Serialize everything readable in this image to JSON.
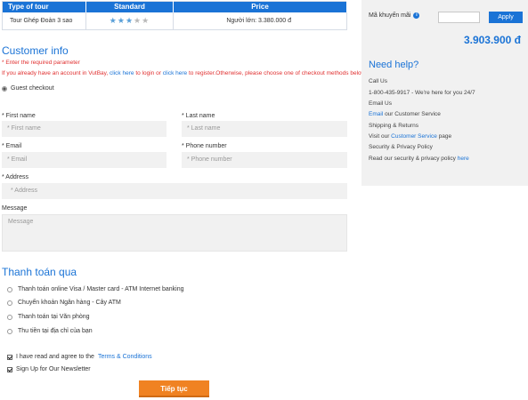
{
  "tour_table": {
    "headers": [
      "Type of tour",
      "Standard",
      "Price"
    ],
    "row": {
      "tour": "Tour Ghép Đoàn 3 sao",
      "stars_filled": 3,
      "stars_total": 5,
      "price": "Người lớn:  3.380.000 đ"
    }
  },
  "customer_info": {
    "title": "Customer info",
    "required_note": "* Enter the required parameter",
    "login_prefix": "If you already have an account in VutBay, ",
    "login_link1": "click here",
    "login_mid": " to login or ",
    "login_link2": "click here",
    "login_suffix": " to register.Otherwise, please choose one of checkout methods below",
    "guest_label": "Guest checkout"
  },
  "form": {
    "first_name": {
      "label": "First name",
      "placeholder": "* First name"
    },
    "last_name": {
      "label": "Last name",
      "placeholder": "* Last name"
    },
    "email": {
      "label": "Email",
      "placeholder": "* Email"
    },
    "phone": {
      "label": "Phone number",
      "placeholder": "* Phone number"
    },
    "address": {
      "label": "Address",
      "placeholder": "* Address"
    },
    "message": {
      "label": "Message",
      "placeholder": "Message"
    }
  },
  "payment": {
    "title": "Thanh toán qua",
    "options": [
      "Thanh toán online Visa / Master card - ATM Internet banking",
      "Chuyển khoản Ngân hàng - Cây ATM",
      "Thanh toán tại Văn phòng",
      "Thu tiền tại địa chỉ của bạn"
    ]
  },
  "agreements": {
    "terms_prefix": "I have read and agree to the ",
    "terms_link": "Terms & Conditions",
    "newsletter": "Sign Up for Our Newsletter"
  },
  "submit_label": "Tiếp tục",
  "sidebar": {
    "promo_label": "Mã khuyến mãi",
    "apply_label": "Apply",
    "total": "3.903.900 đ",
    "help_title": "Need help?",
    "call_us": "Call Us",
    "phone_line": "1-800-435-9917 - We're here for you 24/7",
    "email_us": "Email Us",
    "email_link": "Email",
    "email_suffix": " our Customer Service",
    "shipping": "Shipping & Returns",
    "visit_prefix": "Visit our ",
    "visit_link": "Customer Service",
    "visit_suffix": " page",
    "security": "Security & Privacy Policy",
    "read_prefix": "Read our security & privacy policy ",
    "read_link": "here"
  },
  "colors": {
    "accent": "#1a73d6",
    "error": "#e03030",
    "cta": "#f08222"
  }
}
